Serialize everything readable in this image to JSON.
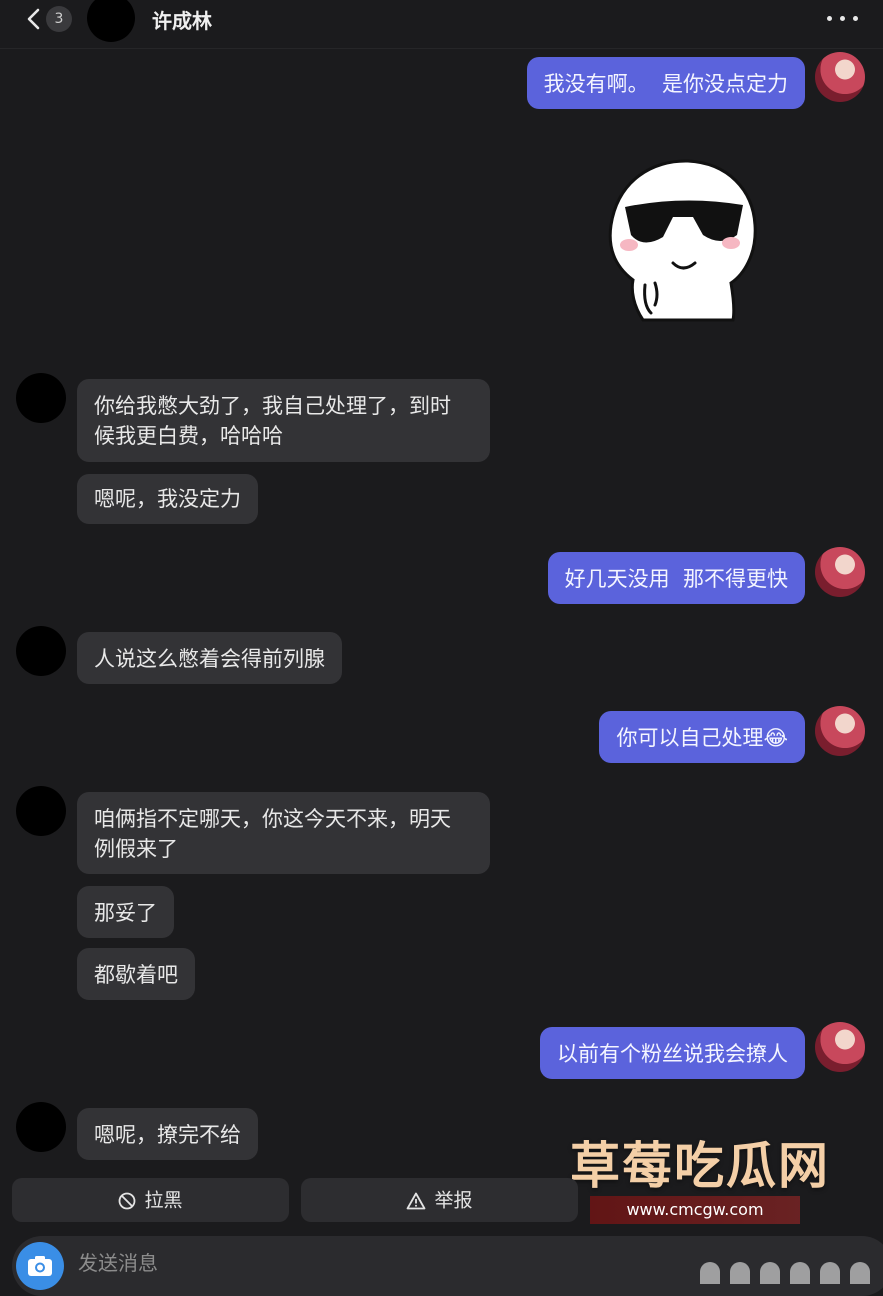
{
  "header": {
    "unread_count": "3",
    "contact_name": "许成林"
  },
  "messages": [
    {
      "side": "me",
      "text": "我没有啊。  是你没点定力"
    },
    {
      "side": "them",
      "text": "你给我憋大劲了，我自己处理了，到时\n候我更白费，哈哈哈"
    },
    {
      "side": "them",
      "text": "嗯呢，我没定力"
    },
    {
      "side": "me",
      "text": "好几天没用  那不得更快"
    },
    {
      "side": "them",
      "text": "人说这么憋着会得前列腺"
    },
    {
      "side": "me",
      "text": "你可以自己处理😂"
    },
    {
      "side": "them",
      "text": "咱俩指不定哪天，你这今天不来，明天\n例假来了"
    },
    {
      "side": "them",
      "text": "那妥了"
    },
    {
      "side": "them",
      "text": "都歇着吧"
    },
    {
      "side": "me",
      "text": "以前有个粉丝说我会撩人"
    },
    {
      "side": "them",
      "text": "嗯呢，撩完不给"
    }
  ],
  "sticker": {
    "icon": "sunglasses-sticker-icon"
  },
  "actions": {
    "block_label": "拉黑",
    "report_label": "举报"
  },
  "input": {
    "placeholder": "发送消息"
  },
  "watermark": {
    "title": "草莓吃瓜网",
    "url": "www.cmcgw.com"
  },
  "colors": {
    "background": "#1b1b1d",
    "my_bubble": "#5b63dc",
    "their_bubble": "#333336",
    "camera": "#3a8ee6"
  }
}
